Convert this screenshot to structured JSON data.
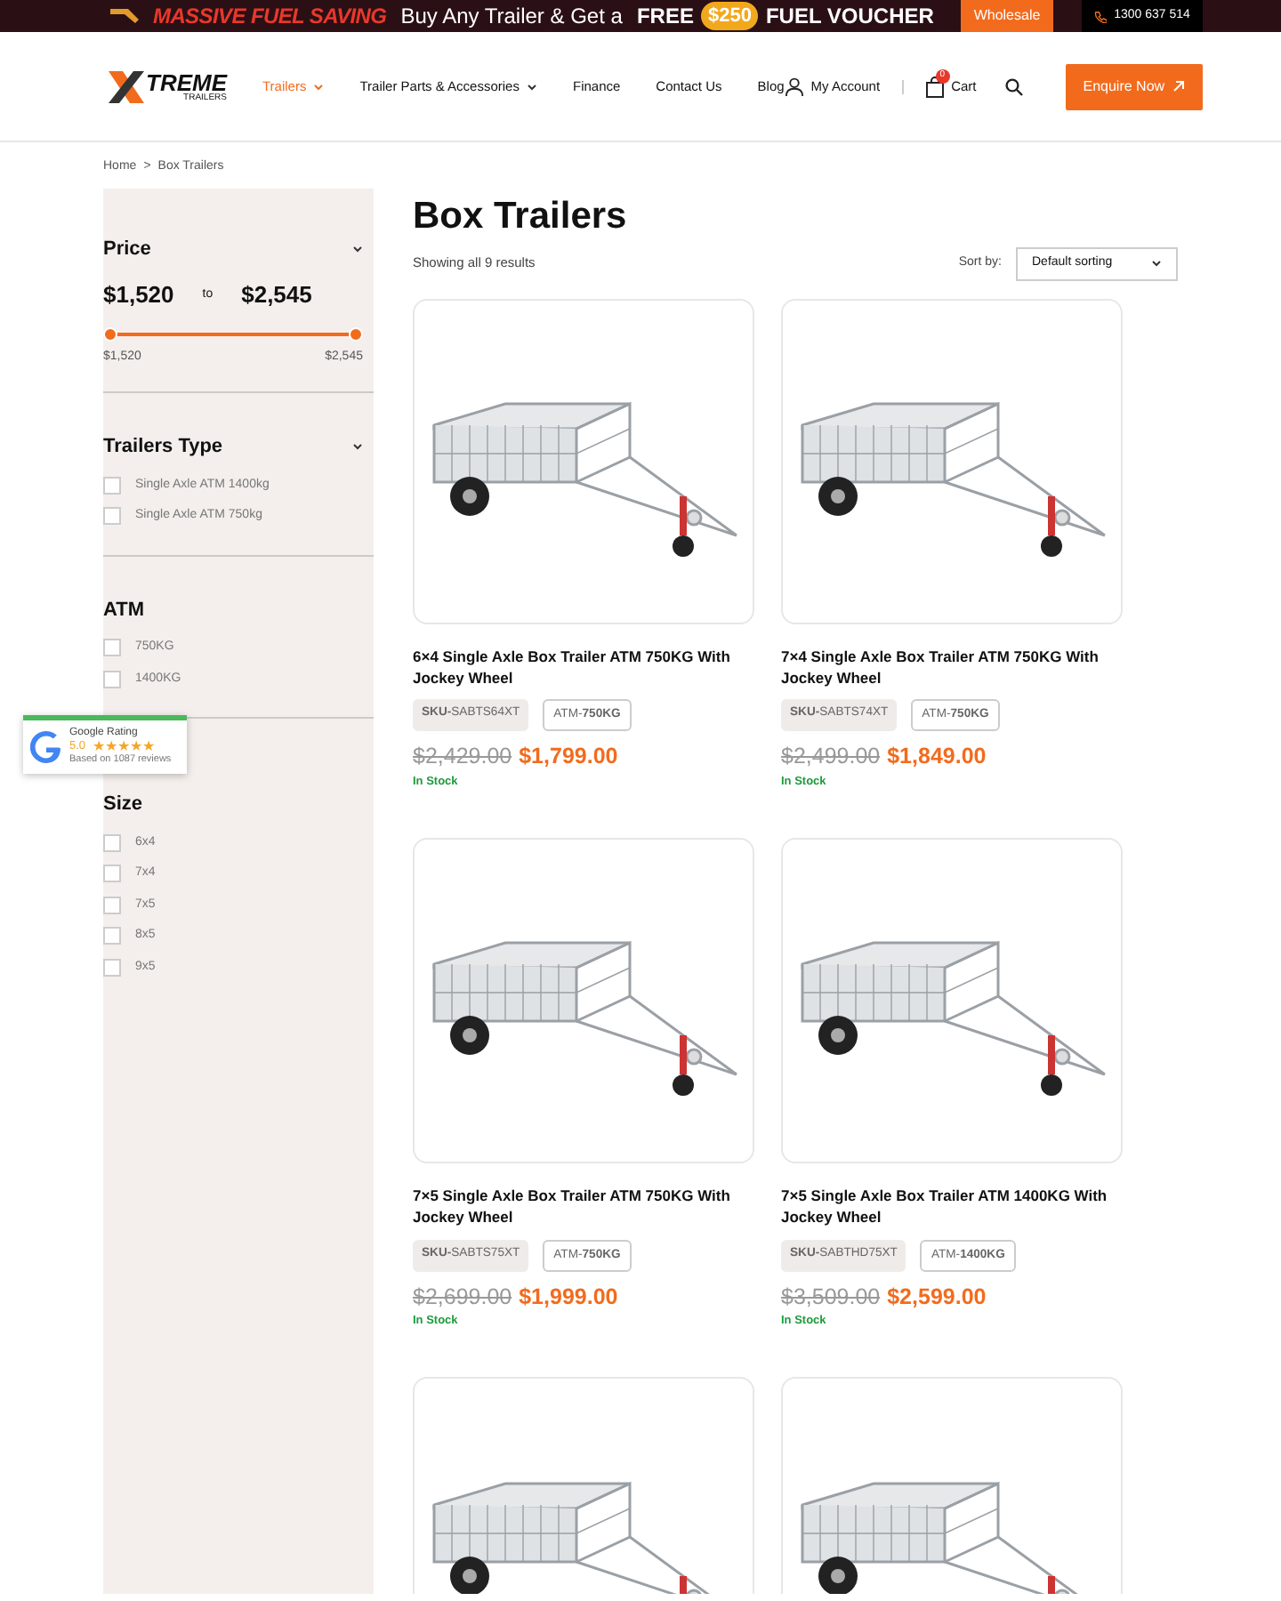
{
  "promo_banner": {
    "headline": "MASSIVE FUEL SAVING",
    "text": "Buy Any Trailer & Get a",
    "free": "FREE",
    "amount": "$250",
    "voucher": "FUEL VOUCHER",
    "wholesale": "Wholesale",
    "phone": "1300 637 514"
  },
  "logo": {
    "name": "TREME",
    "sub": "TRAILERS"
  },
  "nav": [
    {
      "label": "Trailers",
      "selected": true,
      "dropdown": true
    },
    {
      "label": "Trailer Parts & Accessories",
      "selected": false,
      "dropdown": true
    },
    {
      "label": "Finance",
      "selected": false,
      "dropdown": false
    },
    {
      "label": "Contact Us",
      "selected": false,
      "dropdown": false
    },
    {
      "label": "Blog",
      "selected": false,
      "dropdown": false
    }
  ],
  "account": "My Account",
  "cart": {
    "label": "Cart",
    "count": "0"
  },
  "enquire": "Enquire Now",
  "breadcrumb": {
    "home": "Home",
    "separator": ">",
    "current": "Box Trailers"
  },
  "filters": {
    "price": {
      "title": "Price",
      "min": "$1,520",
      "to": "to",
      "max": "$2,545",
      "min_label": "$1,520",
      "max_label": "$2,545",
      "level": 1
    },
    "groups": [
      {
        "title": "Trailers Type",
        "caret": true,
        "options": [
          {
            "label": "Single Axle ATM 1400kg",
            "checked": false
          },
          {
            "label": "Single Axle ATM 750kg",
            "checked": false
          }
        ]
      },
      {
        "title": "ATM",
        "caret": false,
        "options": [
          {
            "label": "750KG",
            "checked": false
          },
          {
            "label": "1400KG",
            "checked": false
          }
        ]
      },
      {
        "title": "Size",
        "caret": false,
        "options": [
          {
            "label": "6x4",
            "checked": false
          },
          {
            "label": "7x4",
            "checked": false
          },
          {
            "label": "7x5",
            "checked": false
          },
          {
            "label": "8x5",
            "checked": false
          },
          {
            "label": "9x5",
            "checked": false
          }
        ]
      }
    ]
  },
  "rating": {
    "title": "Google Rating",
    "score": "5.0",
    "stars": 5,
    "reviews": "Based on 1087 reviews"
  },
  "page_title": "Box Trailers",
  "result_count": "Showing all 9 results",
  "sort": {
    "label": "Sort by:",
    "value": "Default sorting"
  },
  "products": [
    {
      "kind": "full",
      "title": "6×4 Single Axle Box Trailer ATM 750KG With Jockey Wheel",
      "sku": "**SKU-**SABTS64XT",
      "atm": "ATM-**750KG**",
      "old_price": "$2,429.00",
      "price": "$1,799.00",
      "stock": "In Stock"
    },
    {
      "kind": "full",
      "title": "7×4 Single Axle Box Trailer ATM 750KG With Jockey Wheel",
      "sku": "**SKU-**SABTS74XT",
      "atm": "ATM-**750KG**",
      "old_price": "$2,499.00",
      "price": "$1,849.00",
      "stock": "In Stock"
    },
    {
      "kind": "full",
      "title": "7×5 Single Axle Box Trailer ATM 750KG With Jockey Wheel",
      "sku": "**SKU-**SABTS75XT",
      "atm": "ATM-**750KG**",
      "old_price": "$2,699.00",
      "price": "$1,999.00",
      "stock": "In Stock"
    },
    {
      "kind": "full",
      "title": "7×5 Single Axle Box Trailer ATM 1400KG With Jockey Wheel",
      "sku": "**SKU-**SABTHD75XT",
      "atm": "ATM-**1400KG**",
      "old_price": "$3,509.00",
      "price": "$2,599.00",
      "stock": "In Stock"
    },
    {
      "kind": "cut"
    },
    {
      "kind": "cut"
    }
  ]
}
